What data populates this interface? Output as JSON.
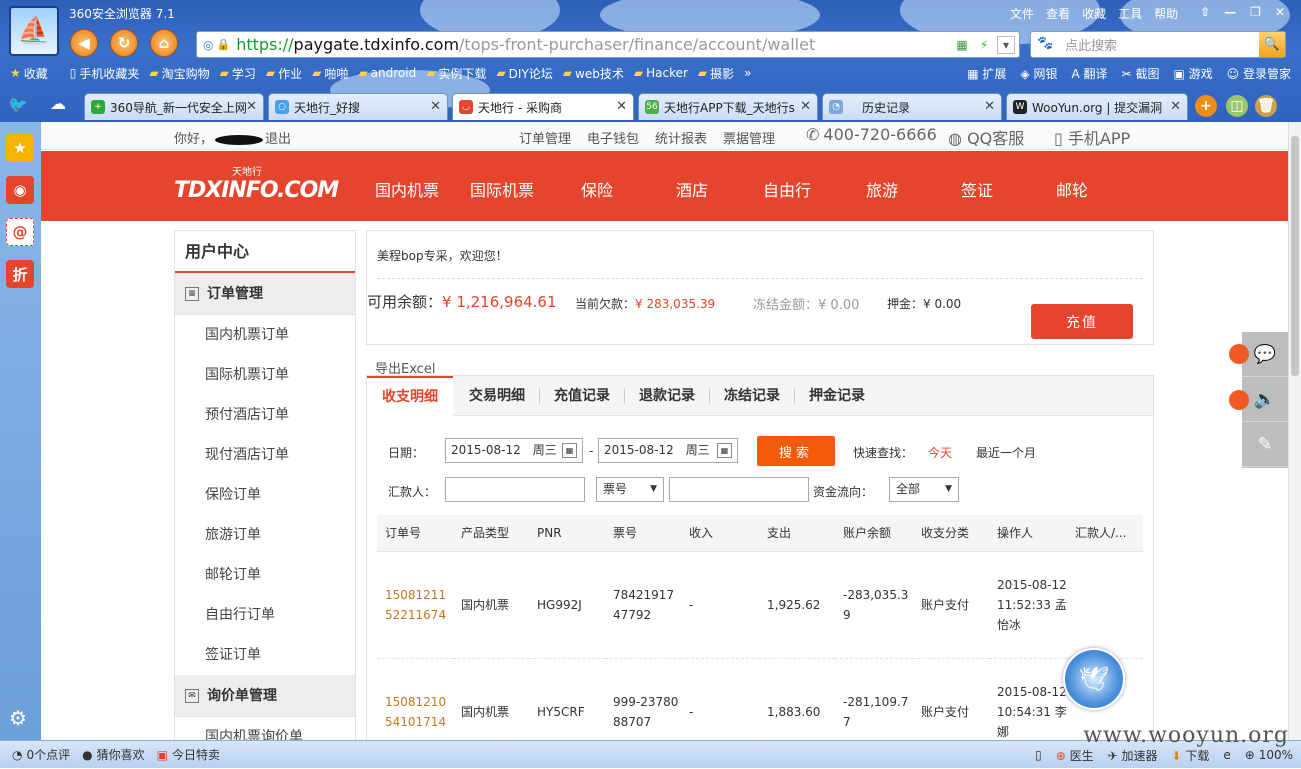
{
  "browser": {
    "title": "360安全浏览器 7.1",
    "url_scheme": "https://",
    "url_host": "paygate.tdxinfo.com",
    "url_path": "/tops-front-purchaser/finance/account/wallet",
    "search_placeholder": "点此搜索",
    "menu": [
      "文件",
      "查看",
      "收藏",
      "工具",
      "帮助"
    ],
    "bookmarks": [
      "收藏",
      "手机收藏夹",
      "淘宝购物",
      "学习",
      "作业",
      "啪啪",
      "android",
      "实例下载",
      "DIY论坛",
      "web技术",
      "Hacker",
      "摄影"
    ],
    "bookmarks_right": [
      "扩展",
      "网银",
      "翻译",
      "截图",
      "游戏",
      "登录管家"
    ],
    "tabs": [
      {
        "label": "360导航_新一代安全上网",
        "color": "#2fa83a",
        "icon_char": "+"
      },
      {
        "label": "天地行_好搜",
        "color": "#4aa0e8",
        "icon_char": "○"
      },
      {
        "label": "天地行 - 采购商",
        "color": "#e4452c",
        "icon_char": "◡"
      },
      {
        "label": "天地行APP下载_天地行s",
        "color": "#4cae4c",
        "icon_char": "56"
      },
      {
        "label": "历史记录",
        "color": "#7fa6d8",
        "icon_char": "◔"
      },
      {
        "label": "WooYun.org | 提交漏洞",
        "color": "#222222",
        "icon_char": "W"
      }
    ],
    "status": [
      "0个点评",
      "猜你喜欢",
      "今日特卖"
    ],
    "status_right": [
      "医生",
      "加速器",
      "下载",
      "100%"
    ],
    "watermark": "www.wooyun.org"
  },
  "site": {
    "greeting_prefix": "你好，",
    "greeting_logout": "退出",
    "top_links": [
      "订单管理",
      "电子钱包",
      "统计报表",
      "票据管理"
    ],
    "phone": "400-720-6666",
    "qq": "QQ客服",
    "app": "手机APP",
    "logo_main": "TDXINFO.COM",
    "logo_cn": "天地行",
    "nav": [
      "国内机票",
      "国际机票",
      "保险",
      "酒店",
      "自由行",
      "旅游",
      "签证",
      "邮轮"
    ]
  },
  "sidebar": {
    "title": "用户中心",
    "group1": "订单管理",
    "items": [
      "国内机票订单",
      "国际机票订单",
      "预付酒店订单",
      "现付酒店订单",
      "保险订单",
      "旅游订单",
      "邮轮订单",
      "自由行订单",
      "签证订单"
    ],
    "group2": "询价单管理",
    "items2": [
      "国内机票询价单"
    ]
  },
  "wallet": {
    "welcome": "美程bop专采，欢迎您！",
    "available_label": "可用余额：",
    "available_value": "¥ 1,216,964.61",
    "owe_label": "当前欠款：",
    "owe_value": "¥ 283,035.39",
    "frozen_label": "冻结金额：",
    "frozen_value": "¥ 0.00",
    "deposit_label": "押金：",
    "deposit_value": "¥ 0.00",
    "recharge": "充值"
  },
  "records": {
    "export": "导出Excel",
    "tabs": [
      "收支明细",
      "交易明细",
      "充值记录",
      "退款记录",
      "冻结记录",
      "押金记录"
    ],
    "filters": {
      "date_label": "日期：",
      "date_from": "2015-08-12　周三",
      "date_to": "2015-08-12　周三",
      "search": "搜索",
      "quick_label": "快速查找：",
      "quick_today": "今天",
      "quick_month": "最近一个月",
      "payer_label": "汇款人：",
      "ticket_select": "票号",
      "flow_label": "资金流向：",
      "flow_select": "全部"
    },
    "columns": [
      "订单号",
      "产品类型",
      "PNR",
      "票号",
      "收入",
      "支出",
      "账户余额",
      "收支分类",
      "操作人",
      "汇款人/..."
    ],
    "rows": [
      {
        "order": "1508121152211674",
        "type": "国内机票",
        "pnr": "HG992J",
        "ticket": "7842191747792",
        "income": "-",
        "expense": "1,925.62",
        "balance": "-283,035.39",
        "category": "账户支付",
        "operator": "2015-08-12 11:52:33 孟怡冰",
        "payer": ""
      },
      {
        "order": "1508121054101714",
        "type": "国内机票",
        "pnr": "HY5CRF",
        "ticket": "999-2378088707",
        "income": "-",
        "expense": "1,883.60",
        "balance": "-281,109.77",
        "category": "账户支付",
        "operator": "2015-08-12 10:54:31 李娜",
        "payer": ""
      }
    ]
  }
}
